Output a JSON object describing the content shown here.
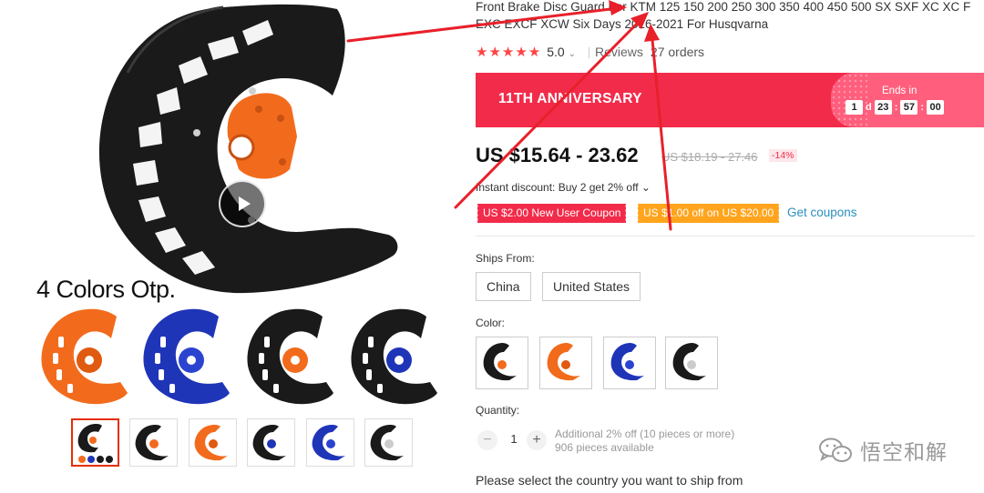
{
  "product": {
    "title": "Front Brake Disc Guard For KTM 125 150 200 250 300 350 400 450 500 SX SXF XC XC F EXC EXCF XCW Six Days 2016-2021 For Husqvarna",
    "rating_stars": "★★★★★",
    "rating_value": "5.0",
    "rating_chevron": "⌄",
    "reviews_label": "Reviews",
    "orders_label": "27 orders"
  },
  "gallery": {
    "colors_caption": "4 Colors Otp.",
    "variants": [
      "orange",
      "blue",
      "black",
      "black-blue"
    ],
    "thumbnails": [
      "all-colors",
      "black",
      "orange",
      "black-blue",
      "blue",
      "black-white"
    ],
    "active_thumbnail": 0
  },
  "promo": {
    "title": "11TH ANNIVERSARY",
    "ends_label": "Ends in",
    "countdown": {
      "days": "1",
      "day_unit": "d",
      "hours": "23",
      "minutes": "57",
      "seconds": "00"
    }
  },
  "pricing": {
    "price": "US $15.64 - 23.62",
    "old_price": "US $18.19 - 27.46",
    "discount": "-14%",
    "instant_discount": "Instant discount: Buy 2 get 2% off",
    "instant_chevron": "⌄",
    "coupon_new_user": "US $2.00 New User Coupon",
    "coupon_off": "US $1.00 off on US $20.00",
    "get_coupons": "Get coupons"
  },
  "options": {
    "ships_from_label": "Ships From:",
    "ships_from": [
      "China",
      "United States"
    ],
    "color_label": "Color:",
    "colors": [
      "black",
      "orange",
      "blue",
      "black-white"
    ],
    "quantity_label": "Quantity:",
    "quantity_value": "1",
    "quantity_minus": "−",
    "quantity_plus": "+",
    "quantity_note_1": "Additional 2% off (10 pieces or more)",
    "quantity_note_2": "906 pieces available",
    "ship_country_prompt": "Please select the country you want to ship from"
  },
  "watermark": {
    "text": "悟空和解"
  },
  "colors": {
    "accent_red": "#f32b4a",
    "banner_pink": "#ff5e7c",
    "coupon_orange": "#ffa41c",
    "link_blue": "#2a8fbd",
    "guard_orange": "#f26b1d",
    "guard_blue": "#1f35b8",
    "guard_black": "#1a1a1a",
    "annotation_arrow": "#e8202a"
  }
}
